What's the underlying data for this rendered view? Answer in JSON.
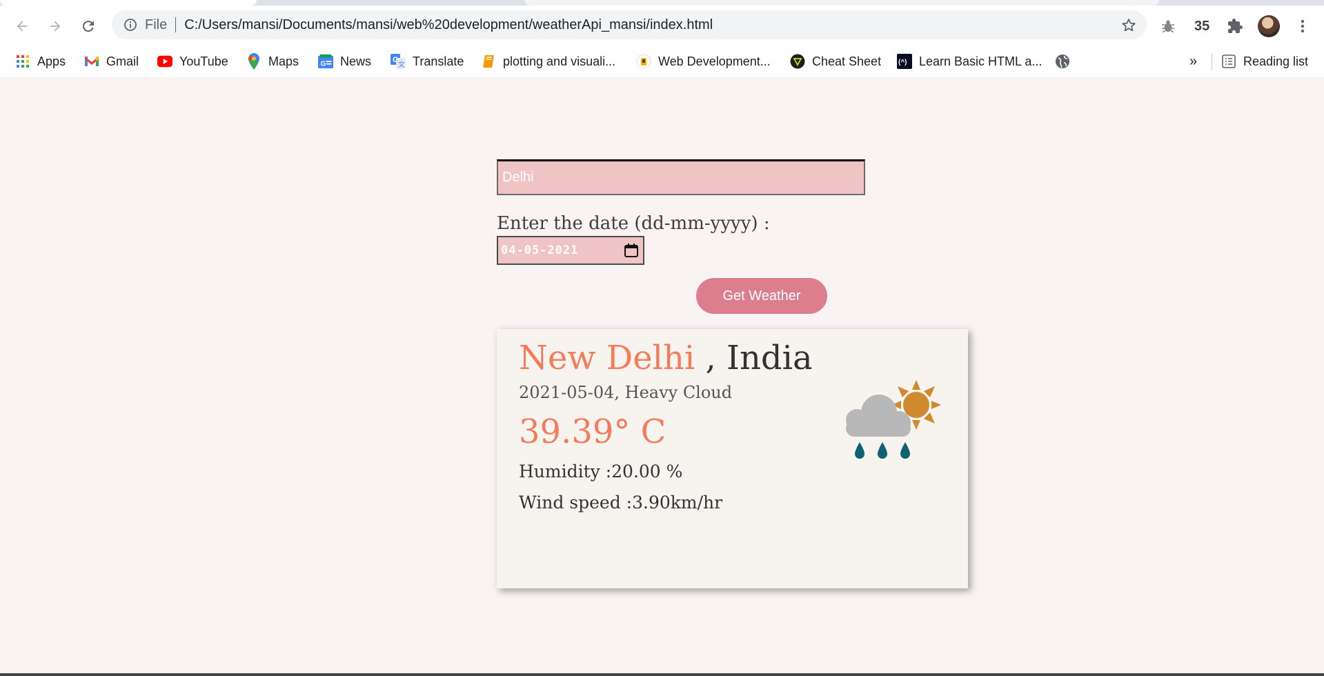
{
  "browser": {
    "address": {
      "scheme_label": "File",
      "url": "C:/Users/mansi/Documents/mansi/web%20development/weatherApi_mansi/index.html"
    },
    "extensions_count": "35",
    "bookmarks": [
      {
        "label": "Apps",
        "icon": "apps-grid-icon"
      },
      {
        "label": "Gmail",
        "icon": "gmail-icon"
      },
      {
        "label": "YouTube",
        "icon": "youtube-icon"
      },
      {
        "label": "Maps",
        "icon": "maps-icon"
      },
      {
        "label": "News",
        "icon": "news-icon"
      },
      {
        "label": "Translate",
        "icon": "translate-icon"
      },
      {
        "label": "plotting and visuali...",
        "icon": "book-icon"
      },
      {
        "label": "Web Development...",
        "icon": "web-dev-icon"
      },
      {
        "label": "Cheat Sheet",
        "icon": "cheat-sheet-icon"
      },
      {
        "label": "Learn Basic HTML a...",
        "icon": "freecodecamp-icon"
      }
    ],
    "overflow_label": "»",
    "reading_list_label": "Reading list"
  },
  "form": {
    "city_value": "Delhi",
    "date_label": "Enter the date (dd-mm-yyyy) :",
    "date_value": "04-05-2021",
    "submit_label": "Get Weather"
  },
  "result": {
    "city": "New Delhi",
    "country": ", India",
    "date_condition": "2021-05-04, Heavy Cloud",
    "temperature": "39.39° C",
    "humidity": "Humidity :20.00 %",
    "wind": "Wind speed :3.90km/hr",
    "icon": "heavy-rain-partly-sunny-icon"
  },
  "colors": {
    "accent": "#f47c5a",
    "button": "#dc7e8d",
    "input_bg": "#f0c3c5",
    "page_bg": "#f9f3f3",
    "card_bg": "#f7f4ef"
  }
}
